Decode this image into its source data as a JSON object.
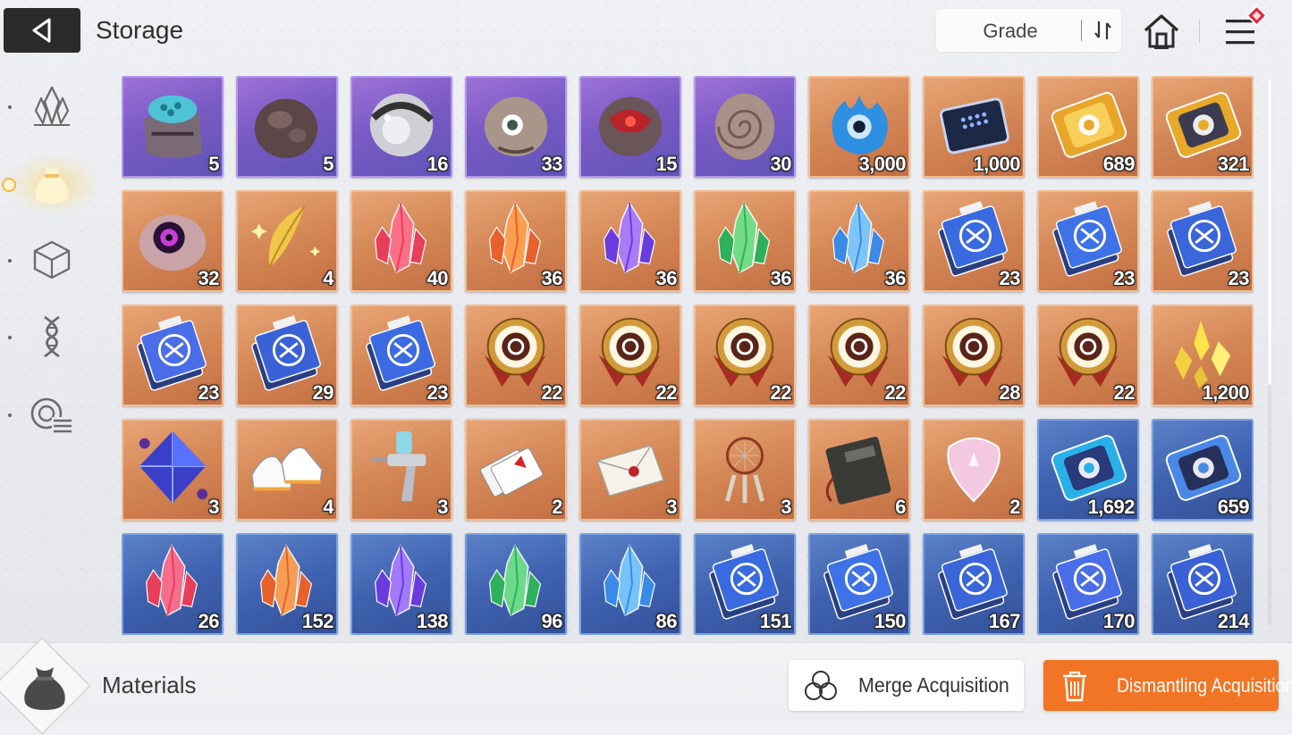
{
  "header": {
    "title": "Storage",
    "back_icon": "back-arrow-icon",
    "sort_label": "Grade",
    "sort_icon": "sort-toggle-icon",
    "home_icon": "home-icon",
    "menu_icon": "menu-icon",
    "menu_badge_color": "#e8243a"
  },
  "sidebar": {
    "items": [
      {
        "icon": "crystal-cluster-icon",
        "active": false
      },
      {
        "icon": "pouch-icon",
        "active": true
      },
      {
        "icon": "cube-icon",
        "active": false
      },
      {
        "icon": "dna-icon",
        "active": false
      },
      {
        "icon": "target-list-icon",
        "active": false
      }
    ],
    "active_color": "#f4b840"
  },
  "grid": {
    "items": [
      {
        "icon": "brain-head-icon",
        "grade": "purple",
        "count": "5"
      },
      {
        "icon": "dark-rock-icon",
        "grade": "purple",
        "count": "5"
      },
      {
        "icon": "silver-orb-icon",
        "grade": "purple",
        "count": "16"
      },
      {
        "icon": "cyclops-skull-icon",
        "grade": "purple",
        "count": "33"
      },
      {
        "icon": "red-core-rock-icon",
        "grade": "purple",
        "count": "15"
      },
      {
        "icon": "spiral-shell-icon",
        "grade": "purple",
        "count": "30"
      },
      {
        "icon": "blue-flame-eye-icon",
        "grade": "orange",
        "count": "3,000"
      },
      {
        "icon": "chip-device-icon",
        "grade": "orange",
        "count": "1,000"
      },
      {
        "icon": "gold-portrait-ticket-icon",
        "grade": "orange",
        "count": "689"
      },
      {
        "icon": "gold-star-ticket-icon",
        "grade": "orange",
        "count": "321"
      },
      {
        "icon": "purple-eye-flesh-icon",
        "grade": "orange",
        "count": "32"
      },
      {
        "icon": "golden-feather-icon",
        "grade": "orange",
        "count": "4"
      },
      {
        "icon": "red-crystal-icon",
        "grade": "orange",
        "count": "40"
      },
      {
        "icon": "orange-crystal-icon",
        "grade": "orange",
        "count": "36"
      },
      {
        "icon": "purple-crystal-icon",
        "grade": "orange",
        "count": "36"
      },
      {
        "icon": "green-crystal-icon",
        "grade": "orange",
        "count": "36"
      },
      {
        "icon": "blue-crystal-icon",
        "grade": "orange",
        "count": "36"
      },
      {
        "icon": "sword-manual-icon",
        "grade": "orange",
        "count": "23"
      },
      {
        "icon": "shield-manual-icon",
        "grade": "orange",
        "count": "23"
      },
      {
        "icon": "target-manual-icon",
        "grade": "orange",
        "count": "23"
      },
      {
        "icon": "wing-manual-icon",
        "grade": "orange",
        "count": "23"
      },
      {
        "icon": "bolt-manual-icon",
        "grade": "orange",
        "count": "29"
      },
      {
        "icon": "orb-manual-icon",
        "grade": "orange",
        "count": "23"
      },
      {
        "icon": "sword-medal-icon",
        "grade": "orange",
        "count": "22"
      },
      {
        "icon": "shield-medal-icon",
        "grade": "orange",
        "count": "22"
      },
      {
        "icon": "target-medal-icon",
        "grade": "orange",
        "count": "22"
      },
      {
        "icon": "wing-medal-icon",
        "grade": "orange",
        "count": "22"
      },
      {
        "icon": "bolt-medal-icon",
        "grade": "orange",
        "count": "28"
      },
      {
        "icon": "orb-medal-icon",
        "grade": "orange",
        "count": "22"
      },
      {
        "icon": "yellow-shards-icon",
        "grade": "orange",
        "count": "1,200"
      },
      {
        "icon": "blue-octahedron-icon",
        "grade": "orange",
        "count": "3"
      },
      {
        "icon": "sneakers-icon",
        "grade": "orange",
        "count": "4"
      },
      {
        "icon": "spray-gun-icon",
        "grade": "orange",
        "count": "3"
      },
      {
        "icon": "playing-cards-icon",
        "grade": "orange",
        "count": "2"
      },
      {
        "icon": "sealed-letter-icon",
        "grade": "orange",
        "count": "3"
      },
      {
        "icon": "dreamcatcher-icon",
        "grade": "orange",
        "count": "3"
      },
      {
        "icon": "notebook-icon",
        "grade": "orange",
        "count": "6"
      },
      {
        "icon": "guitar-pick-icon",
        "grade": "orange",
        "count": "2"
      },
      {
        "icon": "blue-portrait-ticket-icon",
        "grade": "blue",
        "count": "1,692"
      },
      {
        "icon": "blue-star-ticket-icon",
        "grade": "blue",
        "count": "659"
      },
      {
        "icon": "red-crystal-icon",
        "grade": "blue",
        "count": "26"
      },
      {
        "icon": "orange-crystal-icon",
        "grade": "blue",
        "count": "152"
      },
      {
        "icon": "purple-crystal-icon",
        "grade": "blue",
        "count": "138"
      },
      {
        "icon": "green-crystal-icon",
        "grade": "blue",
        "count": "96"
      },
      {
        "icon": "blue-crystal-icon",
        "grade": "blue",
        "count": "86"
      },
      {
        "icon": "sword-manual-icon",
        "grade": "blue",
        "count": "151"
      },
      {
        "icon": "shield-manual-icon",
        "grade": "blue",
        "count": "150"
      },
      {
        "icon": "target-manual-icon",
        "grade": "blue",
        "count": "167"
      },
      {
        "icon": "wing-manual-icon",
        "grade": "blue",
        "count": "170"
      },
      {
        "icon": "bolt-manual-icon",
        "grade": "blue",
        "count": "214"
      }
    ]
  },
  "footer": {
    "category_icon": "pouch-icon",
    "category_label": "Materials",
    "merge_icon": "merge-circles-icon",
    "merge_label": "Merge Acquisition",
    "dismantle_icon": "trash-icon",
    "dismantle_label": "Dismantling Acquisition",
    "dismantle_color": "#f17524"
  }
}
